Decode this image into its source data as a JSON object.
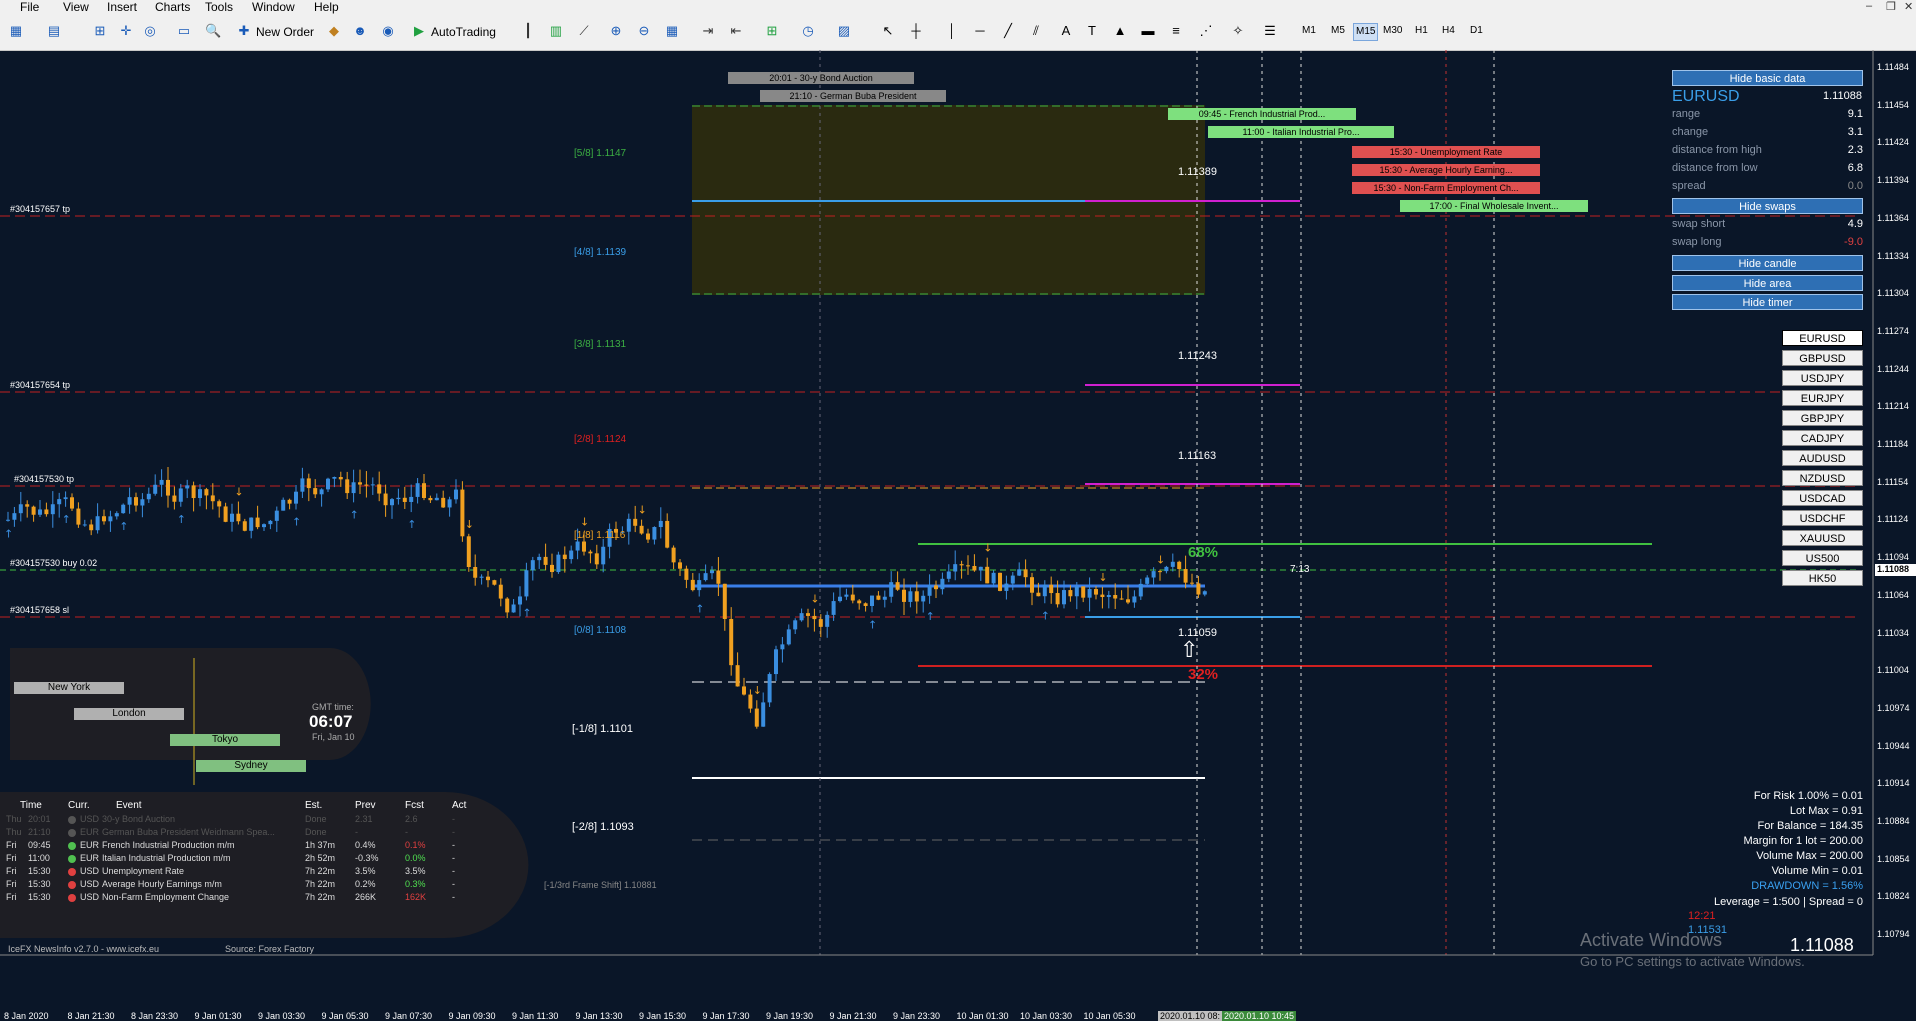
{
  "menu": [
    "File",
    "View",
    "Insert",
    "Charts",
    "Tools",
    "Window",
    "Help"
  ],
  "toolbar": {
    "new_order": "New Order",
    "autotrading": "AutoTrading",
    "timeframes": [
      "M1",
      "M5",
      "M15",
      "M30",
      "H1",
      "H4",
      "D1"
    ],
    "active_tf": "M15"
  },
  "fib_levels": [
    {
      "label": "[5/8]",
      "value": "1.1147",
      "color": "#3cb043"
    },
    {
      "label": "[4/8]",
      "value": "1.1139",
      "color": "#3a9ee8"
    },
    {
      "label": "[3/8]",
      "value": "1.1131",
      "color": "#3cb043"
    },
    {
      "label": "[2/8]",
      "value": "1.1124",
      "color": "#e02020"
    },
    {
      "label": "[1/8]",
      "value": "1.1116",
      "color": "#f0a020"
    },
    {
      "label": "[0/8]",
      "value": "1.1108",
      "color": "#3a9ee8"
    },
    {
      "label": "[-1/8]",
      "value": "1.1101",
      "color": "#ffffff"
    },
    {
      "label": "[-2/8]",
      "value": "1.1093",
      "color": "#ffffff"
    },
    {
      "label": "[-1/3rd Frame Shift]",
      "value": "1.10881",
      "color": "#888888"
    }
  ],
  "order_labels": [
    "#304157657 tp",
    "#304157654 tp",
    "#304157530 tp",
    "#304157530 buy 0.02",
    "#304157658 sl"
  ],
  "price_marks": [
    "1.11389",
    "1.11243",
    "1.11163",
    "1.11059"
  ],
  "pct_up": "68%",
  "pct_down": "32%",
  "countdown": "7:13",
  "news_events": [
    {
      "text": "20:01 - 30-y Bond Auction",
      "color": "#c0c0c0"
    },
    {
      "text": "21:10 - German Buba President",
      "color": "#c0c0c0"
    },
    {
      "text": "09:45 - French Industrial Prod...",
      "color": "#7ee07e"
    },
    {
      "text": "11:00 - Italian Industrial Pro...",
      "color": "#7ee07e"
    },
    {
      "text": "15:30 - Unemployment Rate",
      "color": "#e05050"
    },
    {
      "text": "15:30 - Average Hourly Earning...",
      "color": "#e05050"
    },
    {
      "text": "15:30 - Non-Farm Employment Ch...",
      "color": "#e05050"
    },
    {
      "text": "17:00 - Final Wholesale Invent...",
      "color": "#7ee07e"
    }
  ],
  "panel": {
    "hide_basic": "Hide basic data",
    "symbol": "EURUSD",
    "price": "1.11088",
    "rows": [
      {
        "k": "range",
        "v": "9.1"
      },
      {
        "k": "change",
        "v": "3.1"
      },
      {
        "k": "distance from high",
        "v": "2.3"
      },
      {
        "k": "distance from low",
        "v": "6.8"
      },
      {
        "k": "spread",
        "v": "0.0"
      }
    ],
    "hide_swaps": "Hide swaps",
    "swap_rows": [
      {
        "k": "swap short",
        "v": "4.9"
      },
      {
        "k": "swap long",
        "v": "-9.0"
      }
    ],
    "hide_candle": "Hide candle",
    "hide_area": "Hide area",
    "hide_timer": "Hide timer"
  },
  "symbols": [
    "EURUSD",
    "GBPUSD",
    "USDJPY",
    "EURJPY",
    "GBPJPY",
    "CADJPY",
    "AUDUSD",
    "NZDUSD",
    "USDCAD",
    "USDCHF",
    "XAUUSD",
    "US500",
    "HK50"
  ],
  "map": {
    "sessions": [
      "New York",
      "London",
      "Tokyo",
      "Sydney"
    ],
    "gmt_label": "GMT time:",
    "gmt_time": "06:07",
    "gmt_date": "Fri, Jan 10"
  },
  "calendar": {
    "headers": [
      "Time",
      "Curr.",
      "Event",
      "Est.",
      "Prev",
      "Fcst",
      "Act"
    ],
    "rows": [
      [
        "Thu",
        "20:01",
        "USD",
        "30-y Bond Auction",
        "Done",
        "2.31",
        "2.6",
        "-"
      ],
      [
        "Thu",
        "21:10",
        "EUR",
        "German Buba President Weidmann Spea...",
        "Done",
        "-",
        "-",
        "-"
      ],
      [
        "Fri",
        "09:45",
        "EUR",
        "French Industrial Production m/m",
        "1h 37m",
        "0.4%",
        "0.1%",
        "-"
      ],
      [
        "Fri",
        "11:00",
        "EUR",
        "Italian Industrial Production m/m",
        "2h 52m",
        "-0.3%",
        "0.0%",
        "-"
      ],
      [
        "Fri",
        "15:30",
        "USD",
        "Unemployment Rate",
        "7h 22m",
        "3.5%",
        "3.5%",
        "-"
      ],
      [
        "Fri",
        "15:30",
        "USD",
        "Average Hourly Earnings m/m",
        "7h 22m",
        "0.2%",
        "0.3%",
        "-"
      ],
      [
        "Fri",
        "15:30",
        "USD",
        "Non-Farm Employment Change",
        "7h 22m",
        "266K",
        "162K",
        "-"
      ]
    ],
    "footer_left": "IceFX NewsInfo v2.7.0  -  www.icefx.eu",
    "footer_right": "Source: Forex Factory"
  },
  "risk": [
    "For Risk 1.00% = 0.01",
    "Lot Max = 0.91",
    "For Balance = 184.35",
    "Margin for 1 lot = 200.00",
    "Volume Max = 200.00",
    "Volume Min = 0.01",
    "DRAWDOWN = 1.56%",
    "Leverage = 1:500 | Spread = 0"
  ],
  "timer_small": "1.11531",
  "timer_red": "12:21",
  "big_price": "1.11088",
  "watermark": {
    "line1": "Activate Windows",
    "line2": "Go to PC settings to activate Windows."
  },
  "price_axis": [
    "1.11484",
    "1.11454",
    "1.11424",
    "1.11394",
    "1.11364",
    "1.11334",
    "1.11304",
    "1.11274",
    "1.11244",
    "1.11214",
    "1.11184",
    "1.11154",
    "1.11124",
    "1.11094",
    "1.11064",
    "1.11034",
    "1.11004",
    "1.10974",
    "1.10944",
    "1.10914",
    "1.10884",
    "1.10854",
    "1.10824",
    "1.10794"
  ],
  "time_axis": [
    "8 Jan 2020",
    "8 Jan 21:30",
    "8 Jan 23:30",
    "9 Jan 01:30",
    "9 Jan 03:30",
    "9 Jan 05:30",
    "9 Jan 07:30",
    "9 Jan 09:30",
    "9 Jan 11:30",
    "9 Jan 13:30",
    "9 Jan 15:30",
    "9 Jan 17:30",
    "9 Jan 19:30",
    "9 Jan 21:30",
    "9 Jan 23:30",
    "10 Jan 01:30",
    "10 Jan 03:30",
    "10 Jan 05:30"
  ],
  "time_axis_boxes": [
    "2020.01.10 08:",
    "2020.01.10 10:45"
  ],
  "current_price_tag": "1.11088"
}
